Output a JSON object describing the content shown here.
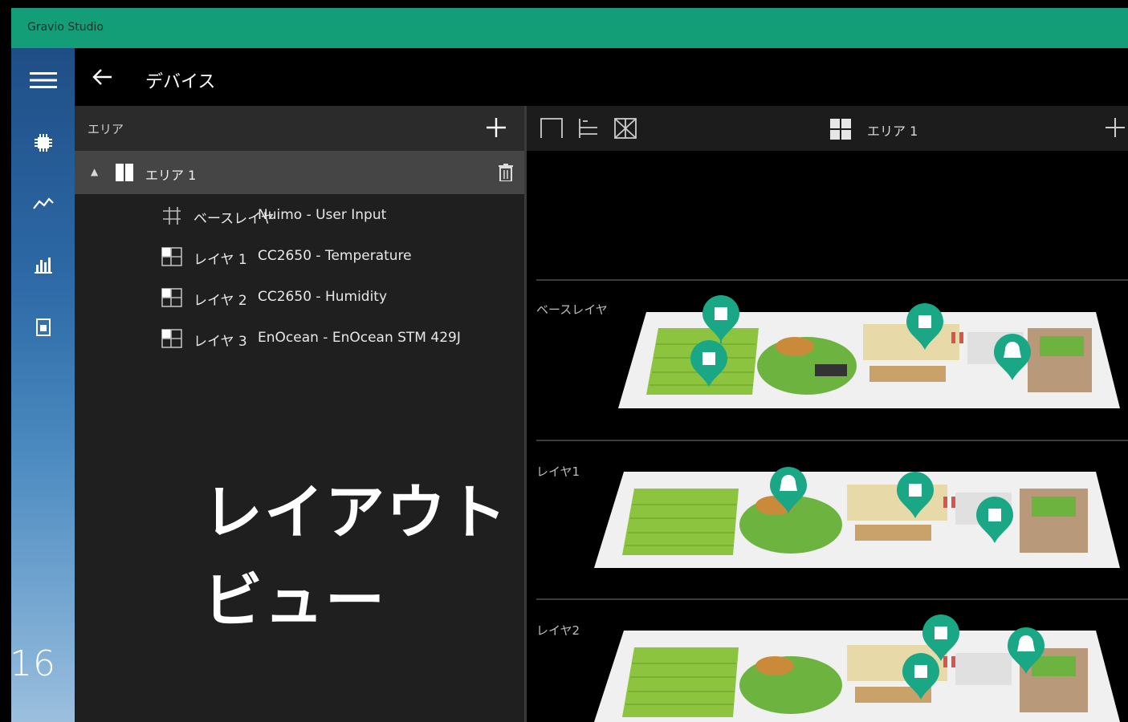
{
  "window": {
    "app_title": "Gravio Studio"
  },
  "header": {
    "page_title": "デバイス"
  },
  "left_panel": {
    "header_label": "エリア",
    "area": {
      "name": "エリア 1"
    },
    "layers": [
      {
        "name": "ベースレイヤ",
        "device": "Nuimo - User Input"
      },
      {
        "name": "レイヤ 1",
        "device": "CC2650 - Temperature"
      },
      {
        "name": "レイヤ 2",
        "device": "CC2650 - Humidity"
      },
      {
        "name": "レイヤ 3",
        "device": "EnOcean - EnOcean STM 429J"
      }
    ]
  },
  "right_panel": {
    "area_label": "エリア 1",
    "layer_labels": [
      "ベースレイヤ",
      "レイヤ1",
      "レイヤ2"
    ]
  },
  "overlay": {
    "caption_line1": "レイアウト",
    "caption_line2": "ビュー",
    "page_number": "16"
  },
  "colors": {
    "titlebar": "#149e78",
    "pin": "#1aa786",
    "rail_top": "#1f4e86",
    "rail_bottom": "#9cbfde"
  }
}
